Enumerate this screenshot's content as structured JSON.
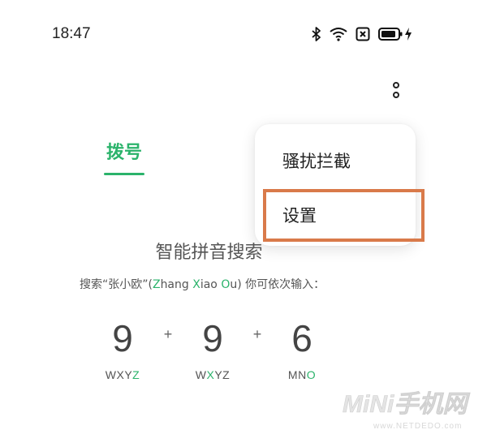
{
  "status_bar": {
    "time": "18:47",
    "icons": [
      "bluetooth-icon",
      "wifi-icon",
      "no-sim-icon",
      "battery-icon",
      "charging-icon"
    ]
  },
  "toolbar": {
    "more_icon": "more-vertical-icon"
  },
  "tabs": [
    {
      "label": "拨号",
      "active": true
    }
  ],
  "popup_menu": {
    "items": [
      {
        "label": "骚扰拦截"
      },
      {
        "label": "设置",
        "highlighted": true
      }
    ]
  },
  "pinyin_search": {
    "title": "智能拼音搜索",
    "hint_prefix": "搜索“张小欧”(",
    "hint_z": "Z",
    "hint_hang": "hang ",
    "hint_x": "X",
    "hint_iao": "iao ",
    "hint_o": "O",
    "hint_suffix": "u) 你可依次输入：",
    "keys": [
      {
        "digit": "9",
        "letters_plain": "WXY",
        "letters_hl": "Z",
        "letters_after": ""
      },
      {
        "digit": "9",
        "letters_plain": "W",
        "letters_hl": "X",
        "letters_after": "YZ"
      },
      {
        "digit": "6",
        "letters_plain": "MN",
        "letters_hl": "O",
        "letters_after": ""
      }
    ],
    "plus": "+"
  },
  "watermark": {
    "brand": "MiNi手机网",
    "url": "www.NETDEDO.com"
  },
  "colors": {
    "accent": "#2bb36b",
    "highlight_border": "#d97a4a"
  }
}
